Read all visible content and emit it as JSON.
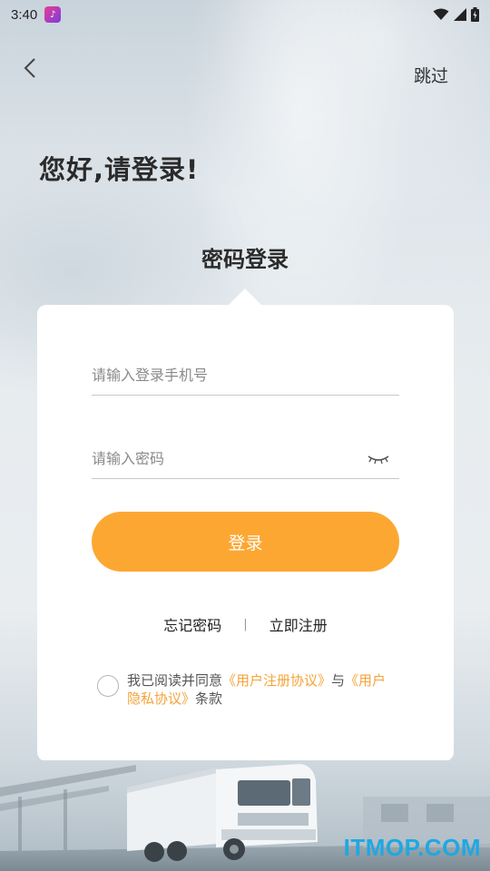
{
  "status_bar": {
    "time": "3:40"
  },
  "header": {
    "skip_label": "跳过"
  },
  "greeting": "您好,请登录!",
  "tab_title": "密码登录",
  "form": {
    "phone_placeholder": "请输入登录手机号",
    "phone_value": "",
    "password_placeholder": "请输入密码",
    "password_value": "",
    "login_label": "登录"
  },
  "links": {
    "forgot_password": "忘记密码",
    "separator": "|",
    "register": "立即注册"
  },
  "agreement": {
    "prefix": "我已阅读并同意",
    "user_agreement": "《用户注册协议》",
    "conjunction": "与",
    "privacy_agreement": "《用户隐私协议》",
    "suffix": "条款",
    "checked": false
  },
  "watermark": "ITMOP.COM",
  "colors": {
    "accent": "#fda733",
    "link": "#f4a33a",
    "watermark": "#1fa8e1"
  },
  "icons": {
    "back": "chevron-left-icon",
    "eye": "eye-closed-icon",
    "wifi": "wifi-icon",
    "signal": "signal-icon",
    "battery": "battery-icon"
  }
}
